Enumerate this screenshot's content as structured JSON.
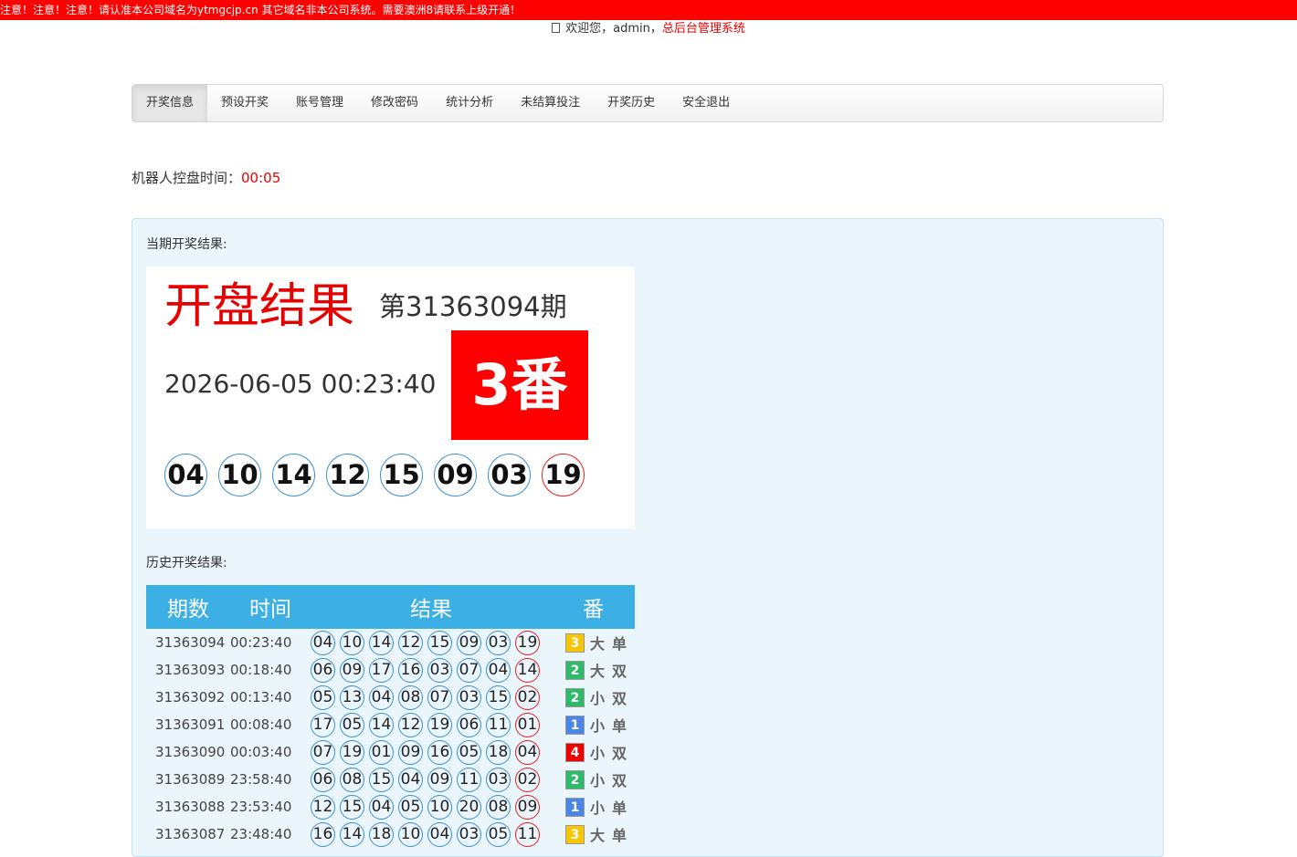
{
  "notice": "注意！注意！注意！请认准本公司域名为ytmgcjp.cn 其它域名非本公司系统。需要澳洲8请联系上级开通！",
  "welcome": {
    "prefix": "欢迎您，admin，",
    "link": "总后台管理系统"
  },
  "nav": [
    "开奖信息",
    "预设开奖",
    "账号管理",
    "修改密码",
    "统计分析",
    "未结算投注",
    "开奖历史",
    "安全退出"
  ],
  "robot": {
    "label": "机器人控盘时间：",
    "value": "00:05"
  },
  "current": {
    "section_label": "当期开奖结果:",
    "title": "开盘结果",
    "issue": "第31363094期",
    "datetime": "2026-06-05 00:23:40",
    "fan": "3番",
    "balls": [
      "04",
      "10",
      "14",
      "12",
      "15",
      "09",
      "03",
      "19"
    ]
  },
  "history": {
    "section_label": "历史开奖结果:",
    "headers": [
      "期数",
      "时间",
      "结果",
      "番"
    ],
    "fan_colors": {
      "1": "#4a86e8",
      "2": "#2dbb6a",
      "3": "#f7c600",
      "4": "#ee0000"
    },
    "rows": [
      {
        "issue": "31363094",
        "time": "00:23:40",
        "balls": [
          "04",
          "10",
          "14",
          "12",
          "15",
          "09",
          "03",
          "19"
        ],
        "fan": "3",
        "size": "大",
        "parity": "单"
      },
      {
        "issue": "31363093",
        "time": "00:18:40",
        "balls": [
          "06",
          "09",
          "17",
          "16",
          "03",
          "07",
          "04",
          "14"
        ],
        "fan": "2",
        "size": "大",
        "parity": "双"
      },
      {
        "issue": "31363092",
        "time": "00:13:40",
        "balls": [
          "05",
          "13",
          "04",
          "08",
          "07",
          "03",
          "15",
          "02"
        ],
        "fan": "2",
        "size": "小",
        "parity": "双"
      },
      {
        "issue": "31363091",
        "time": "00:08:40",
        "balls": [
          "17",
          "05",
          "14",
          "12",
          "19",
          "06",
          "11",
          "01"
        ],
        "fan": "1",
        "size": "小",
        "parity": "单"
      },
      {
        "issue": "31363090",
        "time": "00:03:40",
        "balls": [
          "07",
          "19",
          "01",
          "09",
          "16",
          "05",
          "18",
          "04"
        ],
        "fan": "4",
        "size": "小",
        "parity": "双"
      },
      {
        "issue": "31363089",
        "time": "23:58:40",
        "balls": [
          "06",
          "08",
          "15",
          "04",
          "09",
          "11",
          "03",
          "02"
        ],
        "fan": "2",
        "size": "小",
        "parity": "双"
      },
      {
        "issue": "31363088",
        "time": "23:53:40",
        "balls": [
          "12",
          "15",
          "04",
          "05",
          "10",
          "20",
          "08",
          "09"
        ],
        "fan": "1",
        "size": "小",
        "parity": "单"
      },
      {
        "issue": "31363087",
        "time": "23:48:40",
        "balls": [
          "16",
          "14",
          "18",
          "10",
          "04",
          "03",
          "05",
          "11"
        ],
        "fan": "3",
        "size": "大",
        "parity": "单"
      }
    ]
  }
}
